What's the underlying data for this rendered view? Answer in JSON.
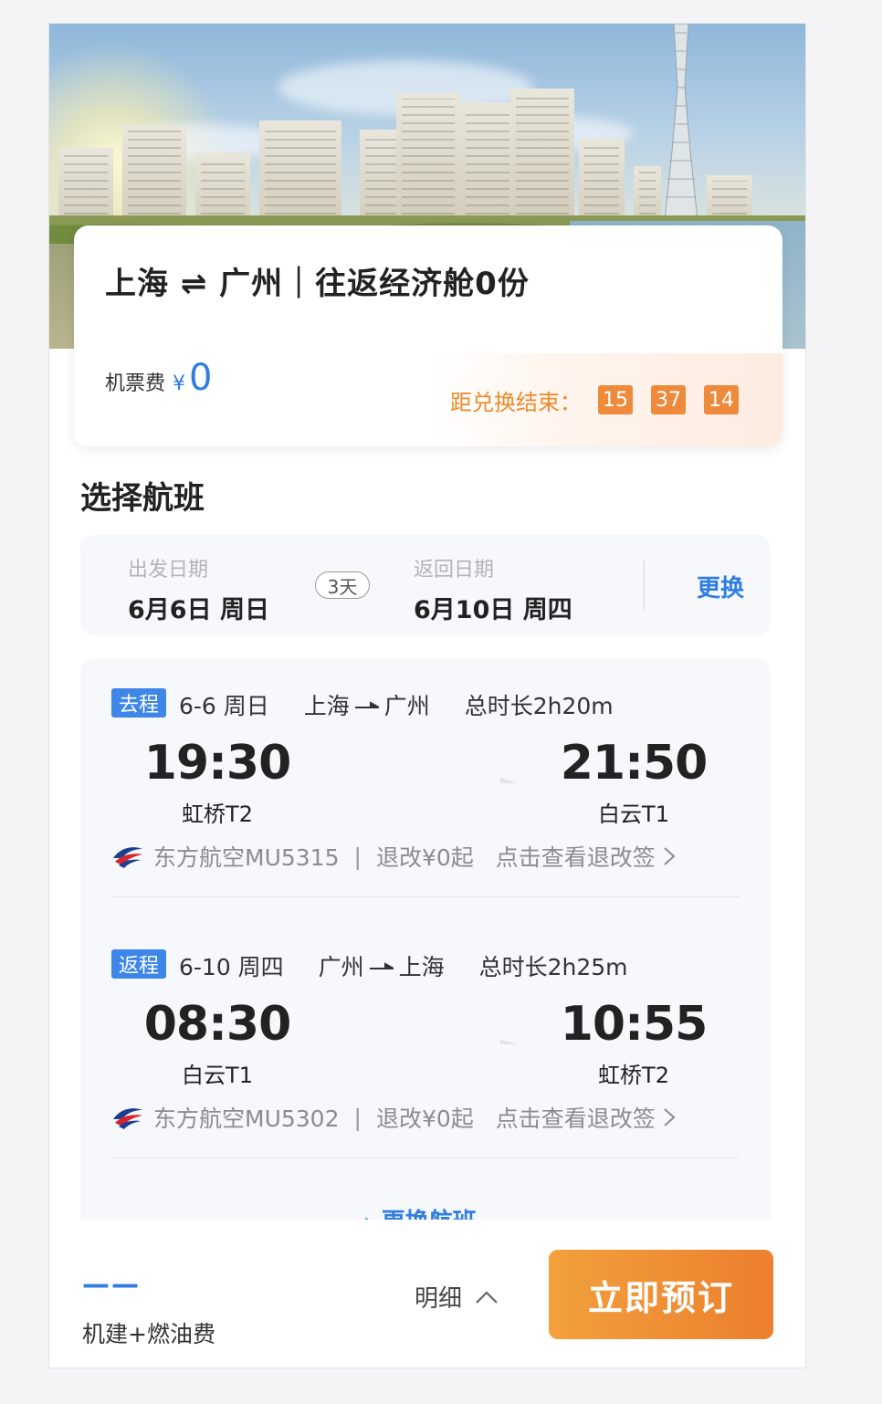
{
  "header": {
    "title": "上海 ⇌ 广州｜往返经济舱0份",
    "fee_label": "机票费",
    "currency": "¥",
    "fee_amount": "0"
  },
  "countdown": {
    "label": "距兑换结束：",
    "hours": "15",
    "minutes": "37",
    "seconds": "14"
  },
  "section_title": "选择航班",
  "dates": {
    "depart_caption": "出发日期",
    "depart_value": "6月6日 周日",
    "days": "3天",
    "return_caption": "返回日期",
    "return_value": "6月10日 周四",
    "change_label": "更换"
  },
  "legs": [
    {
      "tag": "去程",
      "date": "6-6 周日",
      "from": "上海",
      "to": "广州",
      "duration": "总时长2h20m",
      "dep_time": "19:30",
      "dep_terminal": "虹桥T2",
      "arr_time": "21:50",
      "arr_terminal": "白云T1",
      "airline": "东方航空MU5315",
      "refund": "退改¥0起",
      "rules_link": "点击查看退改签"
    },
    {
      "tag": "返程",
      "date": "6-10 周四",
      "from": "广州",
      "to": "上海",
      "duration": "总时长2h25m",
      "dep_time": "08:30",
      "dep_terminal": "白云T1",
      "arr_time": "10:55",
      "arr_terminal": "虹桥T2",
      "airline": "东方航空MU5302",
      "refund": "退改¥0起",
      "rules_link": "点击查看退改签"
    }
  ],
  "more_flights": "› 更换航班",
  "bottom": {
    "price_placeholder": "——",
    "fuel_label": "机建+燃油费",
    "detail_label": "明细",
    "book_label": "立即预订"
  },
  "colors": {
    "accent_blue": "#2f7de1",
    "accent_orange": "#ed8a3b",
    "tag_blue": "#3e86e8"
  }
}
